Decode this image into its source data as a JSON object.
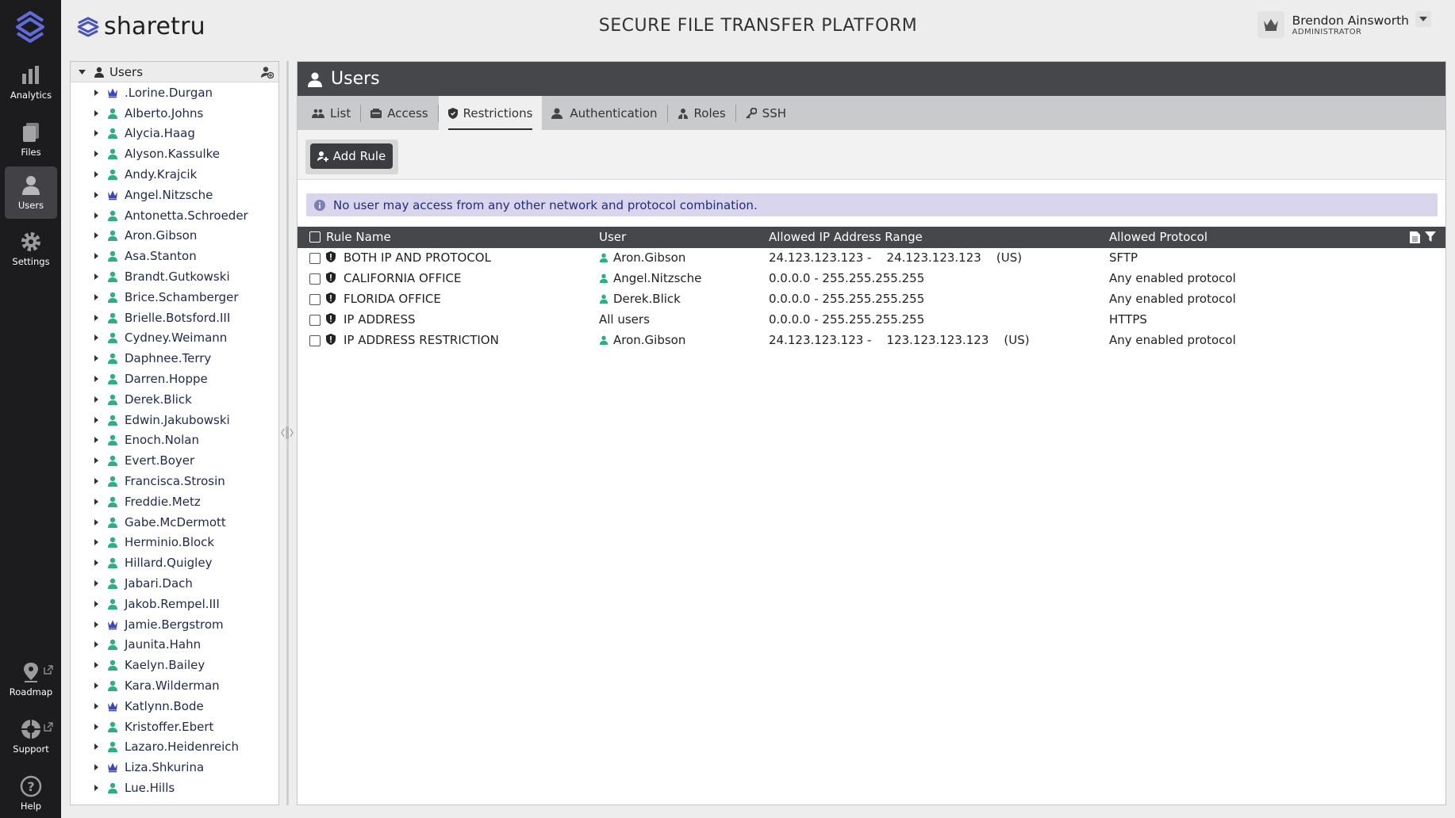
{
  "rail": {
    "items": [
      {
        "label": "Analytics",
        "icon": "analytics-icon"
      },
      {
        "label": "Files",
        "icon": "files-icon"
      },
      {
        "label": "Users",
        "icon": "users-icon",
        "active": true
      },
      {
        "label": "Settings",
        "icon": "gear-icon"
      },
      {
        "label": "Roadmap",
        "icon": "roadmap-icon"
      },
      {
        "label": "Support",
        "icon": "support-icon"
      },
      {
        "label": "Help",
        "icon": "help-icon"
      }
    ]
  },
  "header": {
    "brand": "sharetru",
    "title": "SECURE FILE TRANSFER PLATFORM",
    "user_name": "Brendon Ainsworth",
    "user_role": "ADMINISTRATOR"
  },
  "tree": {
    "root_label": "Users",
    "users": [
      {
        "name": ".Lorine.Durgan",
        "admin": true
      },
      {
        "name": "Alberto.Johns",
        "admin": false
      },
      {
        "name": "Alycia.Haag",
        "admin": false
      },
      {
        "name": "Alyson.Kassulke",
        "admin": false
      },
      {
        "name": "Andy.Krajcik",
        "admin": false
      },
      {
        "name": "Angel.Nitzsche",
        "admin": true
      },
      {
        "name": "Antonetta.Schroeder",
        "admin": false
      },
      {
        "name": "Aron.Gibson",
        "admin": false
      },
      {
        "name": "Asa.Stanton",
        "admin": false
      },
      {
        "name": "Brandt.Gutkowski",
        "admin": false
      },
      {
        "name": "Brice.Schamberger",
        "admin": false
      },
      {
        "name": "Brielle.Botsford.III",
        "admin": false
      },
      {
        "name": "Cydney.Weimann",
        "admin": false
      },
      {
        "name": "Daphnee.Terry",
        "admin": false
      },
      {
        "name": "Darren.Hoppe",
        "admin": false
      },
      {
        "name": "Derek.Blick",
        "admin": false
      },
      {
        "name": "Edwin.Jakubowski",
        "admin": false
      },
      {
        "name": "Enoch.Nolan",
        "admin": false
      },
      {
        "name": "Evert.Boyer",
        "admin": false
      },
      {
        "name": "Francisca.Strosin",
        "admin": false
      },
      {
        "name": "Freddie.Metz",
        "admin": false
      },
      {
        "name": "Gabe.McDermott",
        "admin": false
      },
      {
        "name": "Herminio.Block",
        "admin": false
      },
      {
        "name": "Hillard.Quigley",
        "admin": false
      },
      {
        "name": "Jabari.Dach",
        "admin": false
      },
      {
        "name": "Jakob.Rempel.III",
        "admin": false
      },
      {
        "name": "Jamie.Bergstrom",
        "admin": true
      },
      {
        "name": "Jaunita.Hahn",
        "admin": false
      },
      {
        "name": "Kaelyn.Bailey",
        "admin": false
      },
      {
        "name": "Kara.Wilderman",
        "admin": false
      },
      {
        "name": "Katlynn.Bode",
        "admin": true
      },
      {
        "name": "Kristoffer.Ebert",
        "admin": false
      },
      {
        "name": "Lazaro.Heidenreich",
        "admin": false
      },
      {
        "name": "Liza.Shkurina",
        "admin": true
      },
      {
        "name": "Lue.Hills",
        "admin": false
      }
    ]
  },
  "main": {
    "title": "Users",
    "tabs": [
      {
        "label": "List",
        "icon": "users-group-icon"
      },
      {
        "label": "Access",
        "icon": "access-icon"
      },
      {
        "label": "Restrictions",
        "icon": "shield-icon",
        "active": true
      },
      {
        "label": "Authentication",
        "icon": "authentication-icon"
      },
      {
        "label": "Roles",
        "icon": "roles-icon"
      },
      {
        "label": "SSH",
        "icon": "key-icon"
      }
    ],
    "add_rule_label": "Add Rule",
    "info_message": "No user may access from any other network and protocol combination.",
    "columns": {
      "name": "Rule Name",
      "user": "User",
      "range": "Allowed IP Address Range",
      "protocol": "Allowed Protocol"
    },
    "rules": [
      {
        "name": "BOTH IP AND PROTOCOL",
        "user": "Aron.Gibson",
        "user_is_person": true,
        "range": "24.123.123.123 -    24.123.123.123    (US)",
        "protocol": "SFTP"
      },
      {
        "name": "CALIFORNIA OFFICE",
        "user": "Angel.Nitzsche",
        "user_is_person": true,
        "range": "0.0.0.0 - 255.255.255.255",
        "protocol": "Any enabled protocol"
      },
      {
        "name": "FLORIDA OFFICE",
        "user": "Derek.Blick",
        "user_is_person": true,
        "range": "0.0.0.0 - 255.255.255.255",
        "protocol": "Any enabled protocol"
      },
      {
        "name": "IP ADDRESS",
        "user": "All users",
        "user_is_person": false,
        "range": "0.0.0.0 - 255.255.255.255",
        "protocol": "HTTPS"
      },
      {
        "name": "IP ADDRESS RESTRICTION",
        "user": "Aron.Gibson",
        "user_is_person": true,
        "range": "24.123.123.123 -    123.123.123.123    (US)",
        "protocol": "Any enabled protocol"
      }
    ]
  },
  "colors": {
    "rail_bg": "#1c1c1e",
    "brand_accent": "#4a55b8",
    "user_icon": "#2fae86",
    "admin_icon": "#3b48b4",
    "title_bar": "#46474a",
    "info_bg": "#d9d5ec"
  }
}
